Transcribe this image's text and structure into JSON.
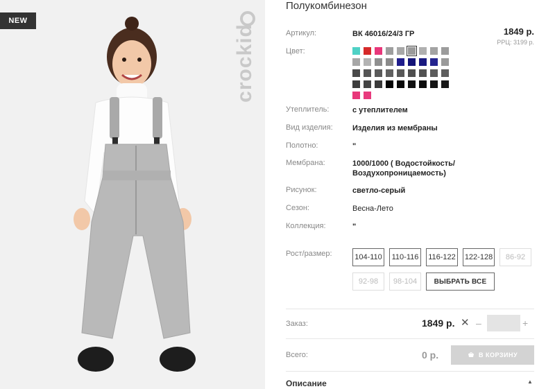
{
  "badge": "NEW",
  "brand": "crockid",
  "product": {
    "title": "Полукомбинезон",
    "price": "1849 р.",
    "rrp": "РРЦ: 3199 р."
  },
  "attributes": [
    {
      "label": "Артикул:",
      "value": "ВК 46016/24/3 ГР"
    },
    {
      "label": "Цвет:",
      "value": ""
    },
    {
      "label": "Утеплитель:",
      "value": "с утеплителем"
    },
    {
      "label": "Вид изделия:",
      "value": "Изделия из мембраны"
    },
    {
      "label": "Полотно:",
      "value": "\""
    },
    {
      "label": "Мембрана:",
      "value": "1000/1000 ( Водостойкость/"
    },
    {
      "label": "",
      "value": "Воздухопроницаемость)"
    },
    {
      "label": "Рисунок:",
      "value": "светло-серый"
    },
    {
      "label": "Сезон:",
      "value": "Весна-Лето"
    },
    {
      "label": "Коллекция:",
      "value": "\""
    },
    {
      "label": "Рост/размер:",
      "value": ""
    }
  ],
  "colors": [
    "#4fd1c5",
    "#d62a2a",
    "#e8377a",
    "#9e9e9e",
    "#a8a8a8",
    "#9a9a9a",
    "#b0b0b0",
    "#a3a3a3",
    "#9c9c9c",
    "#a7a7a7",
    "#b3b3b3",
    "#8f8f8f",
    "#8a8a8a",
    "#1f1d8c",
    "#141478",
    "#1a1a80",
    "#24248f",
    "#9a9a9a",
    "#4a4a4a",
    "#555555",
    "#5a5a5a",
    "#606060",
    "#585858",
    "#4f4f4f",
    "#525252",
    "#5c5c5c",
    "#5e5e5e",
    "#3d3d3d",
    "#444444",
    "#3a3a3a",
    "#050505",
    "#0a0a0a",
    "#111111",
    "#0d0d0d",
    "#151515",
    "#181818",
    "#e8377a",
    "#e83a7d"
  ],
  "sizes": [
    {
      "label": "104-110",
      "disabled": false
    },
    {
      "label": "110-116",
      "disabled": false
    },
    {
      "label": "116-122",
      "disabled": false
    },
    {
      "label": "122-128",
      "disabled": false
    },
    {
      "label": "86-92",
      "disabled": true
    },
    {
      "label": "92-98",
      "disabled": true
    },
    {
      "label": "98-104",
      "disabled": true
    }
  ],
  "select_all_label": "ВЫБРАТЬ ВСЕ",
  "order": {
    "label": "Заказ:",
    "price": "1849 р.",
    "times": "✕",
    "minus": "–",
    "plus": "+",
    "quantity": ""
  },
  "total": {
    "label": "Всего:",
    "price": "0 р.",
    "cart_label": "В КОРЗИНУ"
  },
  "description": {
    "label": "Описание",
    "chevron": "▲"
  },
  "accent": "#333333"
}
